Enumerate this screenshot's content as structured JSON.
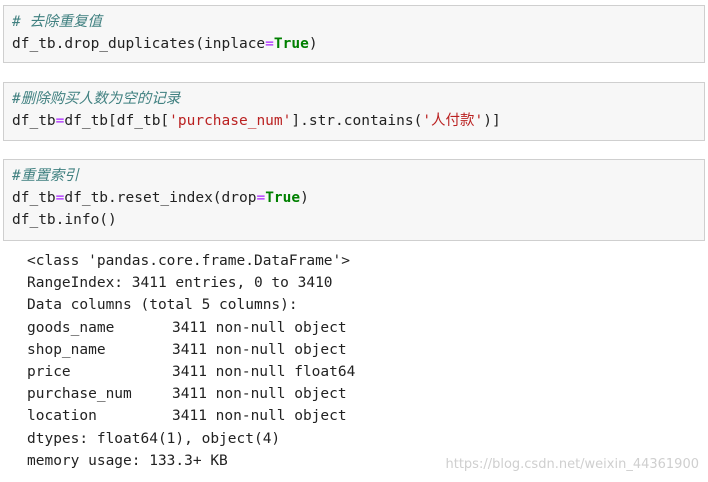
{
  "cells": [
    {
      "comment": "# 去除重复值",
      "code": {
        "c1_pre": "df_tb.drop_duplicates(inplace",
        "c1_eq": "=",
        "c1_kw": "True",
        "c1_post": ")"
      }
    },
    {
      "comment": "#删除购买人数为空的记录",
      "code": {
        "c2_a": "df_tb",
        "c2_eq": "=",
        "c2_b": "df_tb[df_tb[",
        "c2_str": "'purchase_num'",
        "c2_c": "].str.contains(",
        "c2_str2": "'人付款'",
        "c2_d": ")]"
      }
    },
    {
      "comment": "#重置索引",
      "code": {
        "c3_a": "df_tb",
        "c3_eq": "=",
        "c3_b": "df_tb.reset_index(drop",
        "c3_eq2": "=",
        "c3_kw": "True",
        "c3_c": ")",
        "c3_line2": "df_tb.info()"
      }
    }
  ],
  "output": {
    "class_line": "<class 'pandas.core.frame.DataFrame'>",
    "range_index": "RangeIndex: 3411 entries, 0 to 3410",
    "data_columns": "Data columns (total 5 columns):",
    "columns": [
      {
        "name": "goods_name",
        "info": "3411 non-null object"
      },
      {
        "name": "shop_name",
        "info": "3411 non-null object"
      },
      {
        "name": "price",
        "info": "3411 non-null float64"
      },
      {
        "name": "purchase_num",
        "info": "3411 non-null object"
      },
      {
        "name": "location",
        "info": "3411 non-null object"
      }
    ],
    "dtypes": "dtypes: float64(1), object(4)",
    "memory": "memory usage: 133.3+ KB"
  },
  "watermark": "https://blog.csdn.net/weixin_44361900",
  "colors": {
    "cell_bg": "#f7f7f7",
    "cell_border": "#cfcfcf",
    "comment": "#408080",
    "keyword": "#008000",
    "string": "#ba2121",
    "operator": "#aa22ff"
  }
}
